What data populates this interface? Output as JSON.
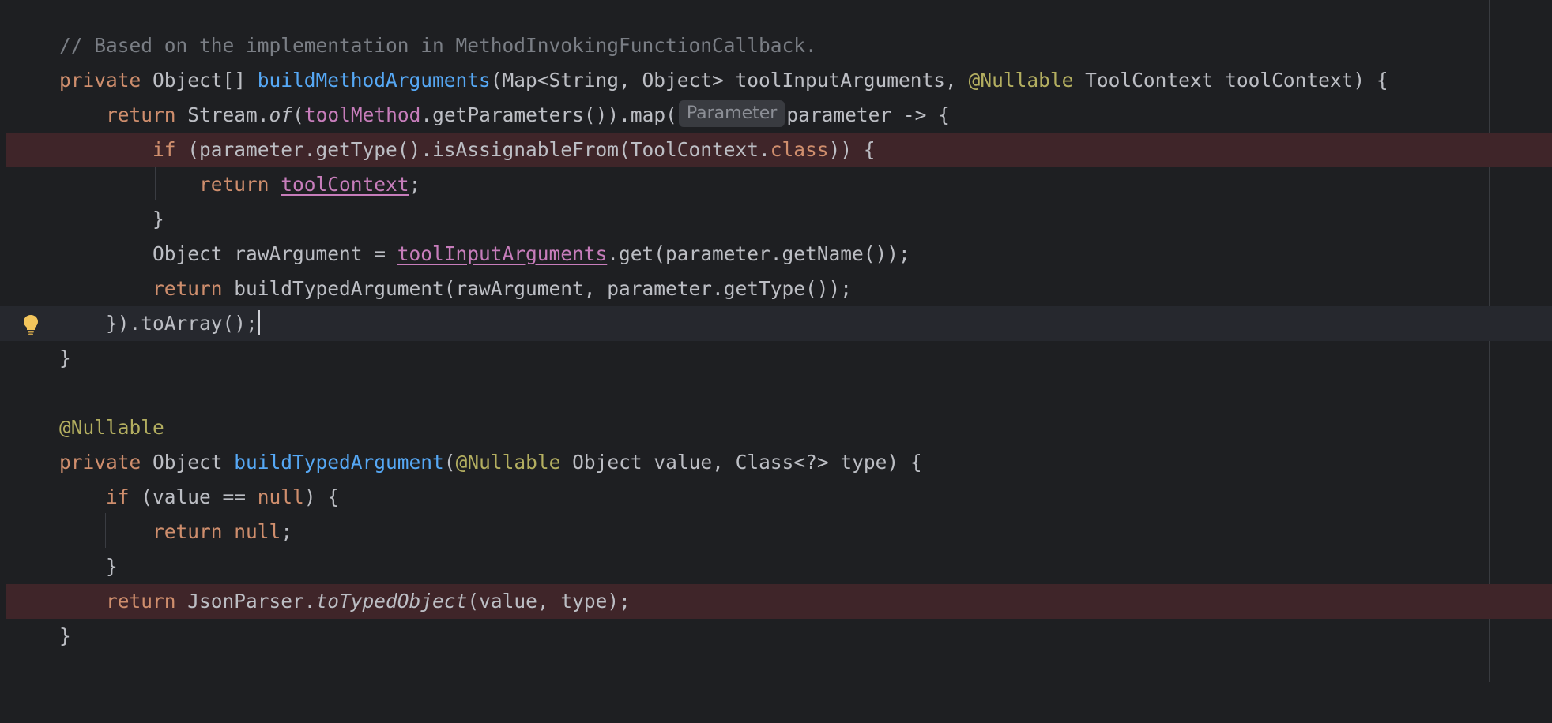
{
  "inlay_hint": "Parameter",
  "lines": {
    "l1": [
      "// Based on the implementation in MethodInvokingFunctionCallback."
    ],
    "l2": [
      "private",
      " Object[] ",
      "buildMethodArguments",
      "(Map<String, Object> toolInputArguments, ",
      "@Nullable",
      " ToolContext toolContext) {"
    ],
    "l3": [
      "    ",
      "return",
      " Stream.",
      "of",
      "(",
      "toolMethod",
      ".getParameters()).map(",
      "parameter -> {"
    ],
    "l4": [
      "        ",
      "if",
      " (parameter.getType().isAssignableFrom(ToolContext.",
      "class",
      ")) {"
    ],
    "l5": [
      "            ",
      "return",
      " ",
      "toolContext",
      ";"
    ],
    "l6": [
      "        }"
    ],
    "l7": [
      "        Object rawArgument = ",
      "toolInputArguments",
      ".get(parameter.getName());"
    ],
    "l8": [
      "        ",
      "return",
      " buildTypedArgument(rawArgument, parameter.getType());"
    ],
    "l9": [
      "    }).toArray();"
    ],
    "l10": [
      "}"
    ],
    "l12": [
      "@Nullable"
    ],
    "l13": [
      "private",
      " Object ",
      "buildTypedArgument",
      "(",
      "@Nullable",
      " Object value, Class<?> type) {"
    ],
    "l14": [
      "    ",
      "if",
      " (value == ",
      "null",
      ") {"
    ],
    "l15": [
      "        ",
      "return",
      " ",
      "null",
      ";"
    ],
    "l16": [
      "    }"
    ],
    "l17": [
      "    ",
      "return",
      " JsonParser.",
      "toTypedObject",
      "(value, type);"
    ],
    "l18": [
      "}"
    ]
  }
}
